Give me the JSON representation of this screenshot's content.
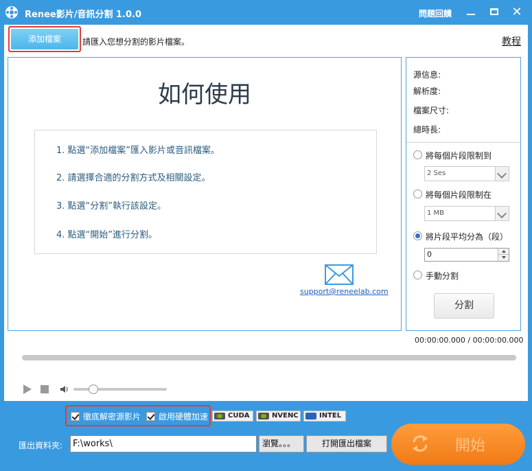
{
  "window": {
    "title": "Renee影片/音訊分割 1.0.0",
    "help_label": "問題回饋"
  },
  "toolbar": {
    "add_button_label": "添加檔案",
    "add_hint": "請匯入您想分割的影片檔案。",
    "tutorial_link": "教程"
  },
  "howto": {
    "title": "如何使用",
    "steps": [
      "1. 點選“添加檔案”匯入影片或音訊檔案。",
      "2. 請選擇合適的分割方式及相關設定。",
      "3. 點選“分割”執行該設定。",
      "4. 點選“開始”進行分割。"
    ],
    "support_email": "support@reneelab.com"
  },
  "info": {
    "source_label": "源信息:",
    "resolution_label": "解析度:",
    "filesize_label": "檔案尺寸:",
    "duration_label": "總時長:"
  },
  "split_options": {
    "opt_duration_label": "將每個片段限制到",
    "opt_duration_value": "2 Ses",
    "opt_size_label": "將每個片段限制在",
    "opt_size_value": "1 MB",
    "opt_average_label": "將片段平均分為（段）",
    "opt_average_value": "0",
    "opt_manual_label": "手動分割",
    "selected": "average",
    "split_button_label": "分割"
  },
  "playback": {
    "time_display": "00:00:00.000 / 00:00:00.000",
    "progress": 0,
    "volume": 0.2
  },
  "options": {
    "decrypt_label": "徹底解密源影片",
    "decrypt_checked": true,
    "hw_accel_label": "啟用硬體加速",
    "hw_accel_checked": true,
    "badges": [
      "CUDA",
      "NVENC",
      "INTEL"
    ]
  },
  "output": {
    "folder_label": "匯出資料夾:",
    "folder_value": "F:\\works\\",
    "browse_label": "瀏覽。。。",
    "open_label": "打開匯出檔案"
  },
  "start_button_label": "開始",
  "colors": {
    "accent_blue": "#3a9ae0",
    "start_orange": "#f58a25",
    "highlight_red": "#e23b3b"
  }
}
